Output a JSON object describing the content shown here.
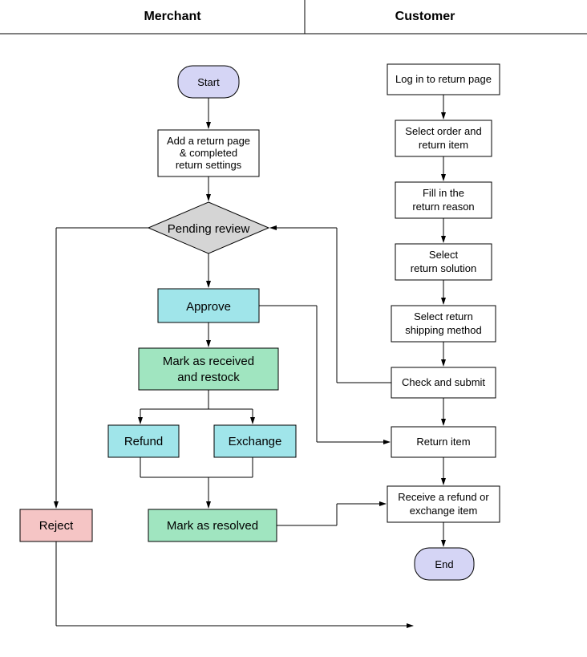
{
  "header": {
    "merchant": "Merchant",
    "customer": "Customer"
  },
  "merchant": {
    "start": "Start",
    "addReturnPage1": "Add a return page",
    "addReturnPage2": "& completed",
    "addReturnPage3": "return settings",
    "pendingReview": "Pending review",
    "approve": "Approve",
    "markReceived1": "Mark as received",
    "markReceived2": "and restock",
    "refund": "Refund",
    "exchange": "Exchange",
    "reject": "Reject",
    "markResolved": "Mark as resolved",
    "end": "End"
  },
  "customer": {
    "login": "Log in to return page",
    "selectOrder1": "Select order and",
    "selectOrder2": "return item",
    "fillReason1": "Fill in the",
    "fillReason2": "return reason",
    "selectSolution1": "Select",
    "selectSolution2": " return solution",
    "selectShipping1": "Select return",
    "selectShipping2": "shipping method",
    "checkSubmit": "Check and submit",
    "returnItem": "Return item",
    "receive1": "Receive a refund or",
    "receive2": "exchange item"
  }
}
